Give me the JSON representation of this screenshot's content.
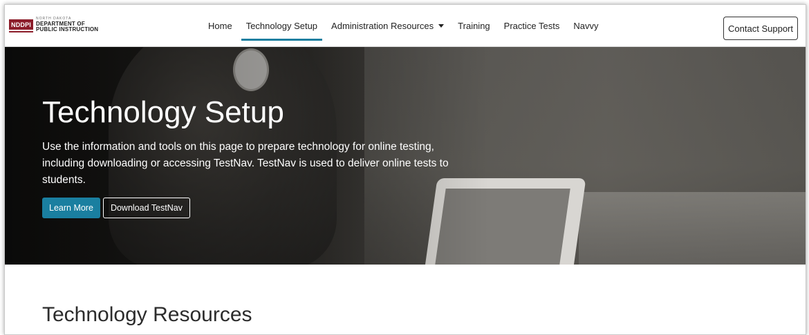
{
  "logo": {
    "mark": "NDDPI",
    "small": "NORTH DAKOTA",
    "line1": "DEPARTMENT OF",
    "line2": "PUBLIC INSTRUCTION"
  },
  "nav": {
    "items": [
      {
        "label": "Home"
      },
      {
        "label": "Technology Setup",
        "active": true
      },
      {
        "label": "Administration Resources",
        "dropdown": true
      },
      {
        "label": "Training"
      },
      {
        "label": "Practice Tests"
      },
      {
        "label": "Navvy"
      }
    ],
    "contact_label": "Contact Support"
  },
  "hero": {
    "title": "Technology Setup",
    "description": "Use the information and tools on this page to prepare technology for online testing, including downloading or accessing TestNav. TestNav is used to deliver online tests to students.",
    "primary_button": "Learn More",
    "secondary_button": "Download TestNav"
  },
  "section": {
    "title": "Technology Resources"
  },
  "colors": {
    "accent": "#1a7fa0",
    "brand": "#8c1d2a"
  }
}
